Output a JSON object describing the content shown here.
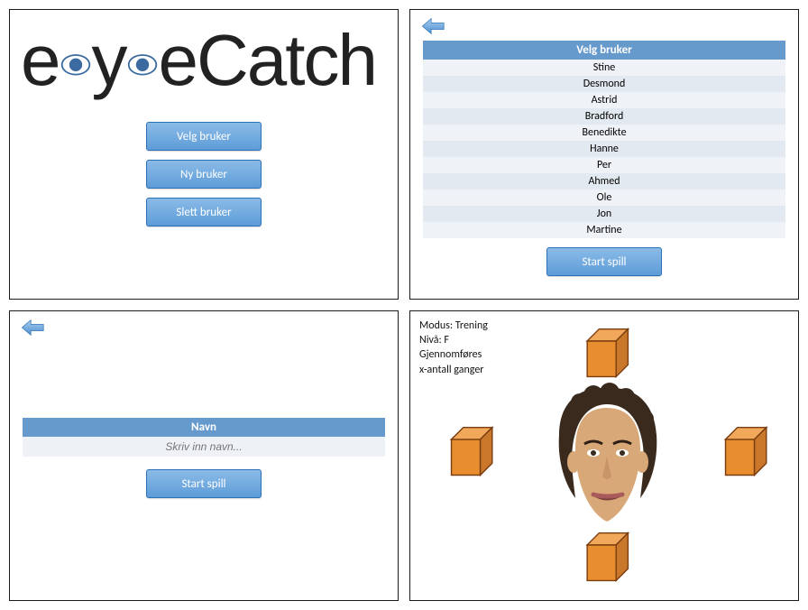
{
  "app": {
    "logo_pre": "e",
    "logo_mid": "eCatch"
  },
  "menu": {
    "select_user": "Velg bruker",
    "new_user": "Ny bruker",
    "delete_user": "Slett bruker"
  },
  "userlist": {
    "header": "Velg bruker",
    "users": [
      "Stine",
      "Desmond",
      "Astrid",
      "Bradford",
      "Benedikte",
      "Hanne",
      "Per",
      "Ahmed",
      "Ole",
      "Jon",
      "Martine"
    ],
    "start": "Start spill"
  },
  "nameform": {
    "header": "Navn",
    "placeholder": "Skriv inn navn...",
    "start": "Start spill"
  },
  "game": {
    "line1": "Modus: Trening",
    "line2": "Nivå: F",
    "line3": "Gjennomføres",
    "line4": "x-antall ganger"
  },
  "colors": {
    "button_top": "#8abbe7",
    "button_bottom": "#5e9cd8",
    "header_bg": "#6699cc",
    "cube_fill": "#e98e2f",
    "cube_stroke": "#7a3d0f"
  }
}
